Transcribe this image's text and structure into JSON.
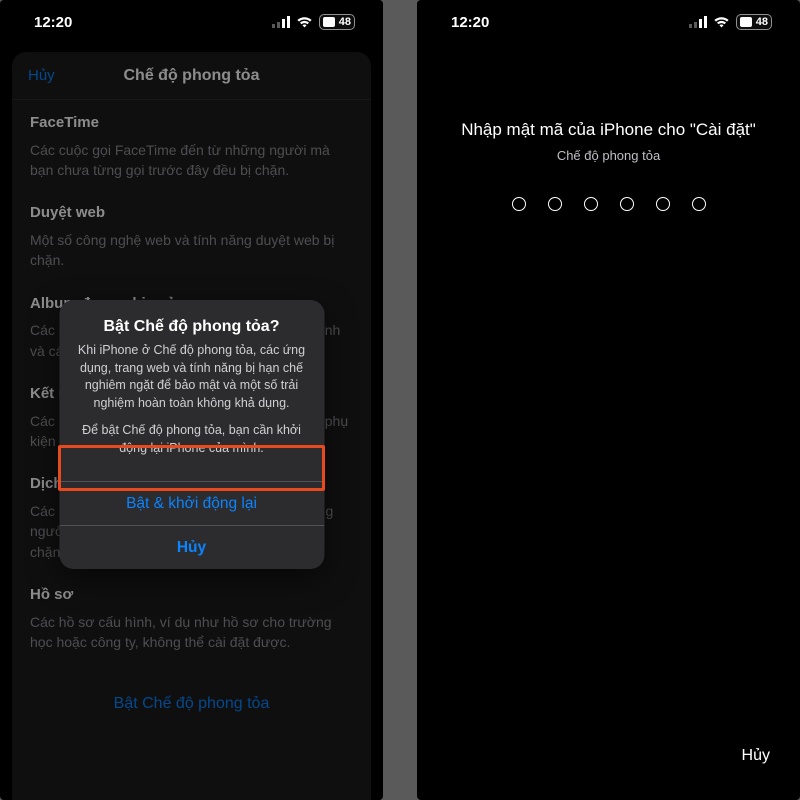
{
  "status": {
    "time": "12:20",
    "battery": "48"
  },
  "left": {
    "cancel": "Hủy",
    "title": "Chế độ phong tỏa",
    "sections": [
      {
        "h": "FaceTime",
        "p": "Các cuộc gọi FaceTime đến từ những người mà bạn chưa từng gọi trước đây đều bị chặn."
      },
      {
        "h": "Duyệt web",
        "p": "Một số công nghệ web và tính năng duyệt web bị chặn."
      },
      {
        "h": "Album được chia sẻ",
        "p": "Các album được chia sẻ bị gỡ khỏi ứng dụng Ảnh và các album được chia sẻ mới sẽ mới bị chặn."
      },
      {
        "h": "Kết nối thiết bị",
        "p": "Các kết nối có dây với máy Mac hoặc PC hoặc phụ kiện bị chặn khi iPhone của bạn bị khóa."
      },
      {
        "h": "Dịch vụ của Apple",
        "p": "Các lời mời đến cho Dịch vụ của Apple từ những người mà bạn chưa từng mời trước đây đều bị chặn."
      },
      {
        "h": "Hồ sơ",
        "p": "Các hồ sơ cấu hình, ví dụ như hồ sơ cho trường học hoặc công ty, không thể cài đặt được."
      }
    ],
    "footer": "Bật Chế độ phong tỏa"
  },
  "alert": {
    "title": "Bật Chế độ phong tỏa?",
    "msg1": "Khi iPhone ở Chế độ phong tỏa, các ứng dụng, trang web và tính năng bị hạn chế nghiêm ngặt để bảo mật và một số trải nghiệm hoàn toàn không khả dụng.",
    "msg2": "Để bật Chế độ phong tỏa, bạn cần khởi động lại iPhone của mình.",
    "primary": "Bật & khởi động lại",
    "cancel": "Hủy"
  },
  "right": {
    "title": "Nhập mật mã của iPhone cho \"Cài đặt\"",
    "sub": "Chế độ phong tỏa",
    "cancel": "Hủy"
  }
}
